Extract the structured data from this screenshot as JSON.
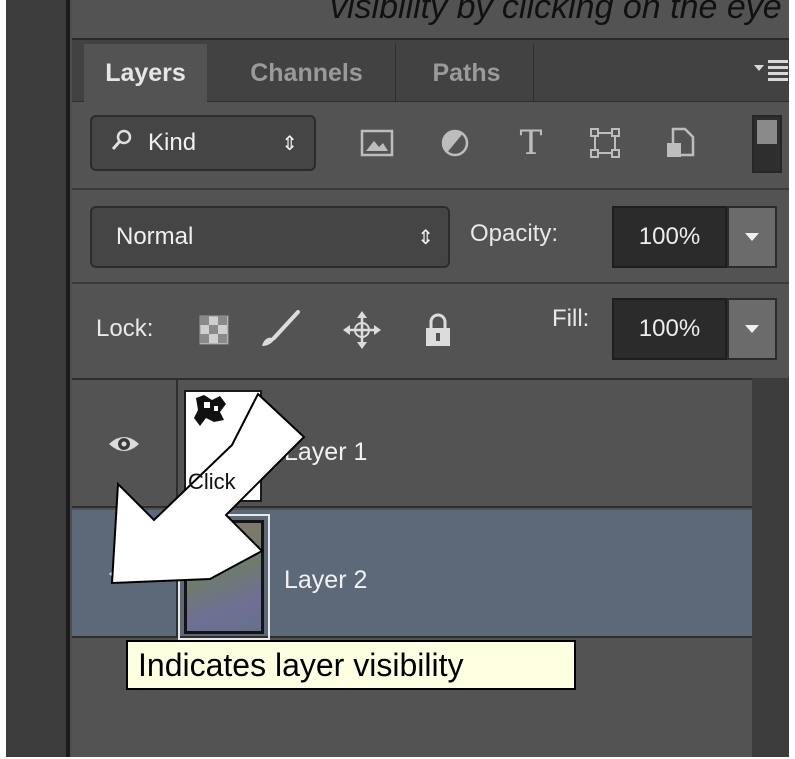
{
  "caption": "visibility by clicking on the eye",
  "tabs": [
    {
      "label": "Layers",
      "active": true
    },
    {
      "label": "Channels",
      "active": false
    },
    {
      "label": "Paths",
      "active": false
    }
  ],
  "panel_menu_icon": "panel-menu-icon",
  "filter": {
    "kind_label": "Kind",
    "icons": [
      "pixel-layer-filter-icon",
      "adjustment-layer-filter-icon",
      "type-layer-filter-icon",
      "shape-layer-filter-icon",
      "smart-object-filter-icon"
    ]
  },
  "blend": {
    "mode": "Normal",
    "opacity_label": "Opacity:",
    "opacity_value": "100%"
  },
  "lock": {
    "label": "Lock:",
    "icons": [
      "lock-transparent-pixels-icon",
      "lock-image-pixels-icon",
      "lock-position-icon",
      "lock-all-icon"
    ],
    "fill_label": "Fill:",
    "fill_value": "100%"
  },
  "layers": [
    {
      "name": "Layer 1",
      "visible": true,
      "selected": false
    },
    {
      "name": "Layer 2",
      "visible": true,
      "selected": true
    }
  ],
  "tooltip": "Indicates layer visibility",
  "annotation": {
    "text": "Click"
  },
  "colors": {
    "panel_bg": "#535353",
    "selected_row": "#5b6978",
    "tooltip_bg": "#ffffe1"
  }
}
